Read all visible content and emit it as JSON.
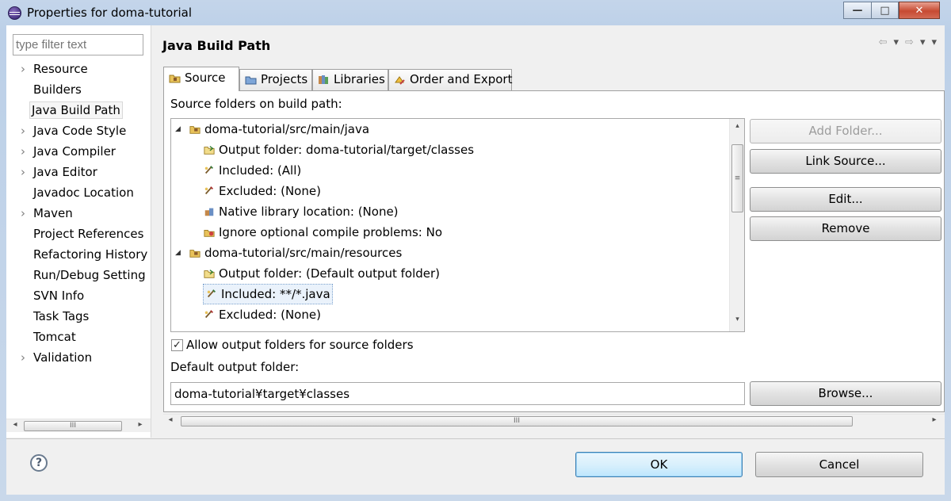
{
  "window": {
    "title": "Properties for doma-tutorial",
    "minimize": "—",
    "maximize": "□",
    "close": "✕"
  },
  "sidebar": {
    "filter_placeholder": "type filter text",
    "items": [
      {
        "label": "Resource",
        "expandable": true
      },
      {
        "label": "Builders",
        "expandable": false
      },
      {
        "label": "Java Build Path",
        "expandable": false,
        "selected": true
      },
      {
        "label": "Java Code Style",
        "expandable": true
      },
      {
        "label": "Java Compiler",
        "expandable": true
      },
      {
        "label": "Java Editor",
        "expandable": true
      },
      {
        "label": "Javadoc Location",
        "expandable": false
      },
      {
        "label": "Maven",
        "expandable": true
      },
      {
        "label": "Project References",
        "expandable": false
      },
      {
        "label": "Refactoring History",
        "expandable": false
      },
      {
        "label": "Run/Debug Setting",
        "expandable": false
      },
      {
        "label": "SVN Info",
        "expandable": false
      },
      {
        "label": "Task Tags",
        "expandable": false
      },
      {
        "label": "Tomcat",
        "expandable": false
      },
      {
        "label": "Validation",
        "expandable": true
      }
    ]
  },
  "page": {
    "title": "Java Build Path",
    "nav": {
      "back": "⇦",
      "back_menu": "▾",
      "forward": "⇨",
      "forward_menu": "▾",
      "menu": "▾"
    }
  },
  "tabs": [
    {
      "label": "Source",
      "icon": "source-folder-icon",
      "active": true
    },
    {
      "label": "Projects",
      "icon": "projects-icon"
    },
    {
      "label": "Libraries",
      "icon": "libraries-icon"
    },
    {
      "label": "Order and Export",
      "icon": "order-export-icon"
    }
  ],
  "source": {
    "heading": "Source folders on build path:",
    "tree": [
      {
        "label": "doma-tutorial/src/main/java",
        "level": 0,
        "icon": "package-folder-icon",
        "expanded": true
      },
      {
        "label": "Output folder: doma-tutorial/target/classes",
        "level": 1,
        "icon": "output-folder-icon"
      },
      {
        "label": "Included: (All)",
        "level": 1,
        "icon": "included-icon"
      },
      {
        "label": "Excluded: (None)",
        "level": 1,
        "icon": "excluded-icon"
      },
      {
        "label": "Native library location: (None)",
        "level": 1,
        "icon": "native-library-icon"
      },
      {
        "label": "Ignore optional compile problems: No",
        "level": 1,
        "icon": "ignore-problems-icon"
      },
      {
        "label": "doma-tutorial/src/main/resources",
        "level": 0,
        "icon": "package-folder-icon",
        "expanded": true
      },
      {
        "label": "Output folder: (Default output folder)",
        "level": 1,
        "icon": "output-folder-icon"
      },
      {
        "label": "Included: **/*.java",
        "level": 1,
        "icon": "included-icon",
        "selected": true
      },
      {
        "label": "Excluded: (None)",
        "level": 1,
        "icon": "excluded-icon"
      }
    ],
    "buttons": {
      "add_folder": "Add Folder...",
      "link_source": "Link Source...",
      "edit": "Edit...",
      "remove": "Remove",
      "browse": "Browse..."
    },
    "allow_output_label": "Allow output folders for source folders",
    "allow_output_checked": true,
    "default_output_label": "Default output folder:",
    "default_output_value": "doma-tutorial¥target¥classes"
  },
  "scroll": {
    "thumb_grip": "III",
    "vgrip": "≡",
    "left": "◂",
    "right": "▸",
    "up": "▴",
    "down": "▾"
  },
  "footer": {
    "help": "?",
    "ok": "OK",
    "cancel": "Cancel"
  },
  "colors": {
    "accent": "#3c7fb1",
    "selection": "#eaf2fb",
    "window_frame": "#bcd0e8"
  }
}
